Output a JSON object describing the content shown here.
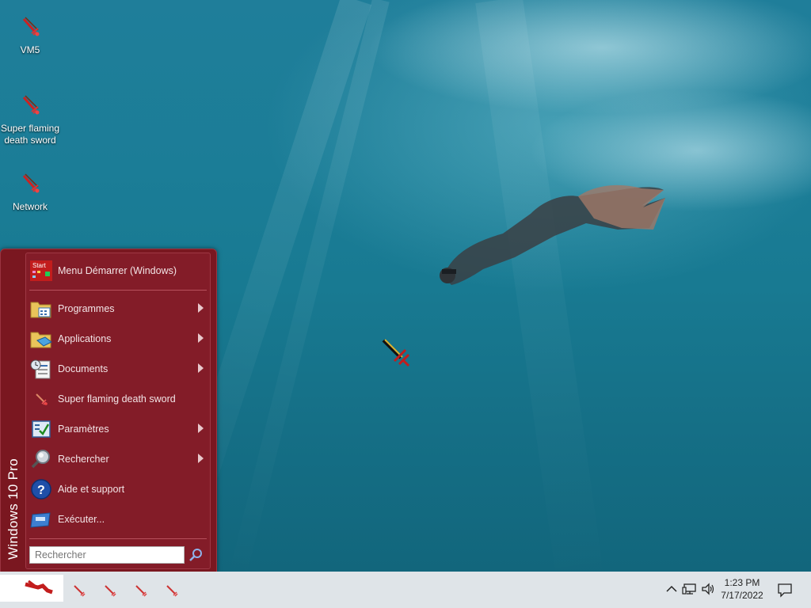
{
  "desktop": {
    "icons": [
      {
        "label": "VM5",
        "icon": "sword-icon"
      },
      {
        "label": "Super flaming death sword",
        "icon": "sword-icon"
      },
      {
        "label": "Network",
        "icon": "sword-icon"
      }
    ]
  },
  "start_menu": {
    "side_label": "Windows 10 Pro",
    "header": {
      "label": "Menu Démarrer (Windows)",
      "icon": "start-logo-icon"
    },
    "items": [
      {
        "label": "Programmes",
        "icon": "programs-folder-icon",
        "submenu": true
      },
      {
        "label": "Applications",
        "icon": "applications-folder-icon",
        "submenu": true
      },
      {
        "label": "Documents",
        "icon": "documents-icon",
        "submenu": true
      },
      {
        "label": "Super flaming death sword",
        "icon": "sword-icon",
        "submenu": false
      },
      {
        "label": "Paramètres",
        "icon": "settings-icon",
        "submenu": true
      },
      {
        "label": "Rechercher",
        "icon": "search-magnifier-icon",
        "submenu": true
      },
      {
        "label": "Aide et support",
        "icon": "help-icon",
        "submenu": false
      },
      {
        "label": "Exécuter...",
        "icon": "run-icon",
        "submenu": false
      }
    ],
    "search": {
      "placeholder": "Rechercher"
    }
  },
  "taskbar": {
    "clock": {
      "time": "1:23 PM",
      "date": "7/17/2022"
    },
    "tray_icons": [
      "chevron-up-icon",
      "network-icon",
      "volume-icon",
      "notifications-icon"
    ]
  },
  "colors": {
    "menu_bg": "#7a1720",
    "panel_bg": "#831c28",
    "taskbar_bg": "#dfe4e8",
    "desktop_water": "#1b7d97"
  }
}
